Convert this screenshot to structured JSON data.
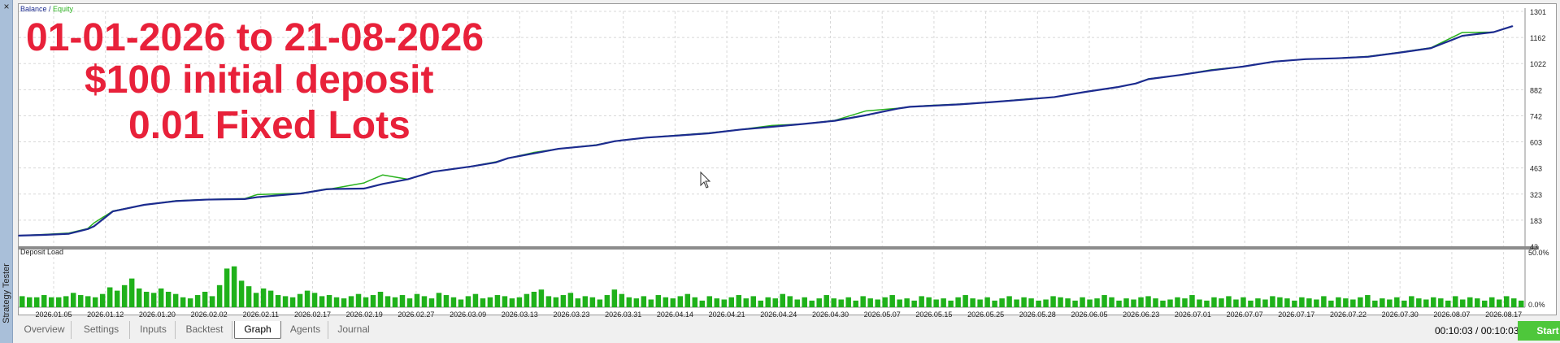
{
  "window": {
    "side_title": "Strategy Tester",
    "close_glyph": "×"
  },
  "chart": {
    "legend": {
      "balance": "Balance",
      "separator": " / ",
      "equity": "Equity"
    },
    "annotation_lines": [
      "01-01-2026 to 21-08-2026",
      "$100 initial deposit",
      "0.01 Fixed Lots"
    ],
    "colors": {
      "balance": "#1c2b8f",
      "equity": "#2bb31f",
      "annotation": "#e8213a",
      "deposit_bar": "#1fb11a",
      "grid": "#d8d8d8"
    }
  },
  "chart_data": [
    {
      "type": "line",
      "title": "",
      "legend": [
        "Balance",
        "Equity"
      ],
      "y_ticks": [
        "1301",
        "1162",
        "1022",
        "882",
        "742",
        "603",
        "463",
        "323",
        "183",
        "43"
      ],
      "ylim": [
        43,
        1301
      ],
      "grid": true,
      "series": [
        {
          "name": "Balance",
          "x_index": [
            0,
            4,
            8,
            11,
            12,
            15,
            20,
            25,
            30,
            36,
            38,
            45,
            49,
            50,
            55,
            58,
            62,
            66,
            72,
            76,
            78,
            82,
            86,
            92,
            95,
            100,
            105,
            110,
            115,
            120,
            125,
            130,
            135,
            140,
            142,
            145,
            150,
            155,
            160,
            165,
            170,
            175,
            178,
            180,
            185,
            190,
            195,
            200,
            205,
            210,
            215,
            220,
            225,
            230,
            235,
            238
          ],
          "values": [
            100,
            104,
            110,
            135,
            150,
            230,
            265,
            285,
            293,
            296,
            306,
            326,
            348,
            350,
            352,
            377,
            402,
            442,
            470,
            492,
            515,
            540,
            565,
            584,
            606,
            625,
            636,
            648,
            668,
            683,
            698,
            715,
            745,
            780,
            790,
            795,
            803,
            815,
            828,
            842,
            870,
            895,
            915,
            938,
            960,
            985,
            1005,
            1032,
            1045,
            1050,
            1058,
            1080,
            1104,
            1170,
            1190,
            1222
          ]
        },
        {
          "name": "Equity",
          "x_index": [
            0,
            4,
            8,
            11,
            12,
            15,
            20,
            25,
            30,
            36,
            38,
            45,
            49,
            50,
            55,
            58,
            62,
            66,
            72,
            76,
            78,
            82,
            86,
            92,
            95,
            100,
            105,
            110,
            115,
            120,
            125,
            130,
            135,
            140,
            142,
            145,
            150,
            155,
            160,
            165,
            170,
            175,
            178,
            180,
            185,
            190,
            195,
            200,
            205,
            210,
            215,
            220,
            225,
            230,
            235,
            238
          ],
          "values": [
            100,
            106,
            114,
            138,
            168,
            232,
            265,
            287,
            294,
            298,
            320,
            327,
            350,
            352,
            382,
            425,
            402,
            442,
            470,
            495,
            515,
            545,
            565,
            586,
            606,
            625,
            638,
            650,
            668,
            690,
            698,
            717,
            768,
            782,
            790,
            797,
            805,
            815,
            830,
            842,
            870,
            895,
            915,
            940,
            960,
            988,
            1005,
            1032,
            1045,
            1050,
            1060,
            1082,
            1106,
            1188,
            1190,
            1222
          ]
        }
      ]
    },
    {
      "type": "bar",
      "title": "Deposit Load",
      "y_ticks": [
        "50.0%",
        "0.0%"
      ],
      "ylim": [
        0,
        50
      ],
      "x_tick_labels": [
        "2026.01.05",
        "2026.01.12",
        "2026.01.20",
        "2026.02.02",
        "2026.02.11",
        "2026.02.17",
        "2026.02.19",
        "2026.02.27",
        "2026.03.09",
        "2026.03.13",
        "2026.03.23",
        "2026.03.31",
        "2026.04.14",
        "2026.04.21",
        "2026.04.24",
        "2026.04.30",
        "2026.05.07",
        "2026.05.15",
        "2026.05.25",
        "2026.05.28",
        "2026.06.05",
        "2026.06.23",
        "2026.07.01",
        "2026.07.07",
        "2026.07.17",
        "2026.07.22",
        "2026.07.30",
        "2026.08.07",
        "2026.08.17"
      ],
      "series": [
        {
          "name": "Deposit Load",
          "values": [
            10,
            9,
            9,
            11,
            9,
            9,
            10,
            13,
            11,
            10,
            9,
            12,
            18,
            15,
            20,
            26,
            17,
            14,
            13,
            17,
            14,
            12,
            9,
            8,
            11,
            14,
            10,
            20,
            35,
            37,
            24,
            19,
            13,
            17,
            15,
            11,
            10,
            9,
            12,
            15,
            13,
            10,
            11,
            9,
            8,
            10,
            12,
            9,
            11,
            14,
            10,
            9,
            11,
            8,
            12,
            10,
            8,
            13,
            11,
            9,
            7,
            10,
            12,
            8,
            9,
            11,
            10,
            8,
            9,
            12,
            14,
            16,
            10,
            9,
            11,
            13,
            8,
            10,
            9,
            7,
            11,
            16,
            12,
            9,
            8,
            10,
            7,
            11,
            9,
            8,
            10,
            12,
            9,
            6,
            10,
            8,
            7,
            9,
            11,
            8,
            10,
            6,
            9,
            8,
            12,
            10,
            7,
            9,
            6,
            8,
            11,
            8,
            7,
            9,
            6,
            10,
            8,
            7,
            9,
            11,
            7,
            8,
            6,
            10,
            9,
            7,
            8,
            6,
            9,
            11,
            8,
            7,
            9,
            6,
            8,
            10,
            7,
            9,
            8,
            6,
            7,
            10,
            9,
            8,
            6,
            9,
            7,
            8,
            11,
            9,
            6,
            8,
            7,
            9,
            10,
            8,
            6,
            7,
            9,
            8,
            11,
            7,
            6,
            9,
            8,
            10,
            7,
            9,
            6,
            8,
            7,
            10,
            9,
            8,
            6,
            9,
            8,
            7,
            10,
            6,
            9,
            8,
            7,
            9,
            11,
            6,
            8,
            7,
            9,
            6,
            10,
            8,
            7,
            9,
            8,
            6,
            10,
            7,
            9,
            8,
            6,
            9,
            7,
            10,
            8,
            6
          ]
        }
      ]
    }
  ],
  "tabs": [
    "Overview",
    "Settings",
    "Inputs",
    "Backtest",
    "Graph",
    "Agents",
    "Journal"
  ],
  "active_tab": "Graph",
  "status": {
    "timer": "00:10:03 / 00:10:03"
  },
  "start_label": "Start",
  "icons": {
    "close": "close-icon",
    "cursor": "mouse-cursor-icon"
  }
}
